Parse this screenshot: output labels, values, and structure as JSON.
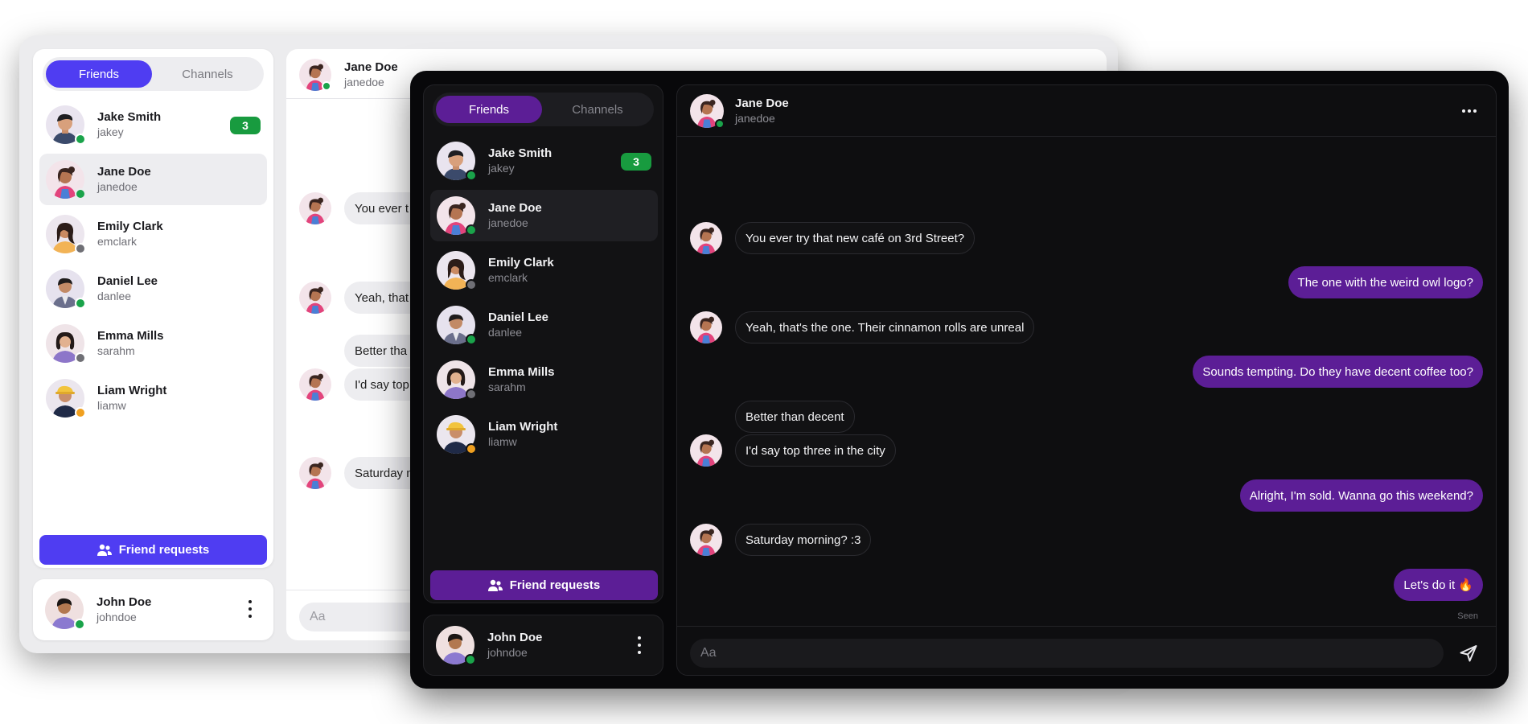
{
  "colors": {
    "light_accent": "#4f3df2",
    "dark_accent": "#5c1e96",
    "status_online": "#1aa34a",
    "status_offline": "#6f6f75",
    "status_away": "#f0a020",
    "badge": "#189b3f"
  },
  "light": {
    "tabs": {
      "friends": "Friends",
      "channels": "Channels"
    },
    "friends": [
      {
        "name": "Jake Smith",
        "username": "jakey",
        "badge": "3",
        "status": "online"
      },
      {
        "name": "Jane Doe",
        "username": "janedoe",
        "status": "online",
        "selected": true
      },
      {
        "name": "Emily Clark",
        "username": "emclark",
        "status": "offline"
      },
      {
        "name": "Daniel Lee",
        "username": "danlee",
        "status": "online"
      },
      {
        "name": "Emma Mills",
        "username": "sarahm",
        "status": "offline"
      },
      {
        "name": "Liam Wright",
        "username": "liamw",
        "status": "away"
      }
    ],
    "friend_requests_label": "Friend requests",
    "current_user": {
      "name": "John Doe",
      "username": "johndoe"
    },
    "chat_header": {
      "name": "Jane Doe",
      "username": "janedoe"
    },
    "messages_visible": [
      "You ever t",
      "Yeah, that",
      "Better tha",
      "I'd say top",
      "Saturday m"
    ],
    "input_placeholder": "Aa"
  },
  "dark": {
    "tabs": {
      "friends": "Friends",
      "channels": "Channels"
    },
    "friends": [
      {
        "name": "Jake Smith",
        "username": "jakey",
        "badge": "3",
        "status": "online"
      },
      {
        "name": "Jane Doe",
        "username": "janedoe",
        "status": "online",
        "selected": true
      },
      {
        "name": "Emily Clark",
        "username": "emclark",
        "status": "offline"
      },
      {
        "name": "Daniel Lee",
        "username": "danlee",
        "status": "online"
      },
      {
        "name": "Emma Mills",
        "username": "sarahm",
        "status": "offline"
      },
      {
        "name": "Liam Wright",
        "username": "liamw",
        "status": "away"
      }
    ],
    "friend_requests_label": "Friend requests",
    "current_user": {
      "name": "John Doe",
      "username": "johndoe"
    },
    "chat_header": {
      "name": "Jane Doe",
      "username": "janedoe"
    },
    "messages": [
      {
        "from": "them",
        "text": "You ever try that new café on 3rd Street?"
      },
      {
        "from": "me",
        "text": "The one with the weird owl logo?"
      },
      {
        "from": "them",
        "text": "Yeah, that's the one. Their cinnamon rolls are unreal"
      },
      {
        "from": "me",
        "text": "Sounds tempting. Do they have decent coffee too?"
      },
      {
        "from": "them",
        "text": "Better than decent"
      },
      {
        "from": "them",
        "text": "I'd say top three in the city"
      },
      {
        "from": "me",
        "text": "Alright, I'm sold. Wanna go this weekend?"
      },
      {
        "from": "them",
        "text": "Saturday morning? :3"
      },
      {
        "from": "me",
        "text": "Let's do it 🔥"
      }
    ],
    "seen_label": "Seen",
    "input_placeholder": "Aa"
  }
}
